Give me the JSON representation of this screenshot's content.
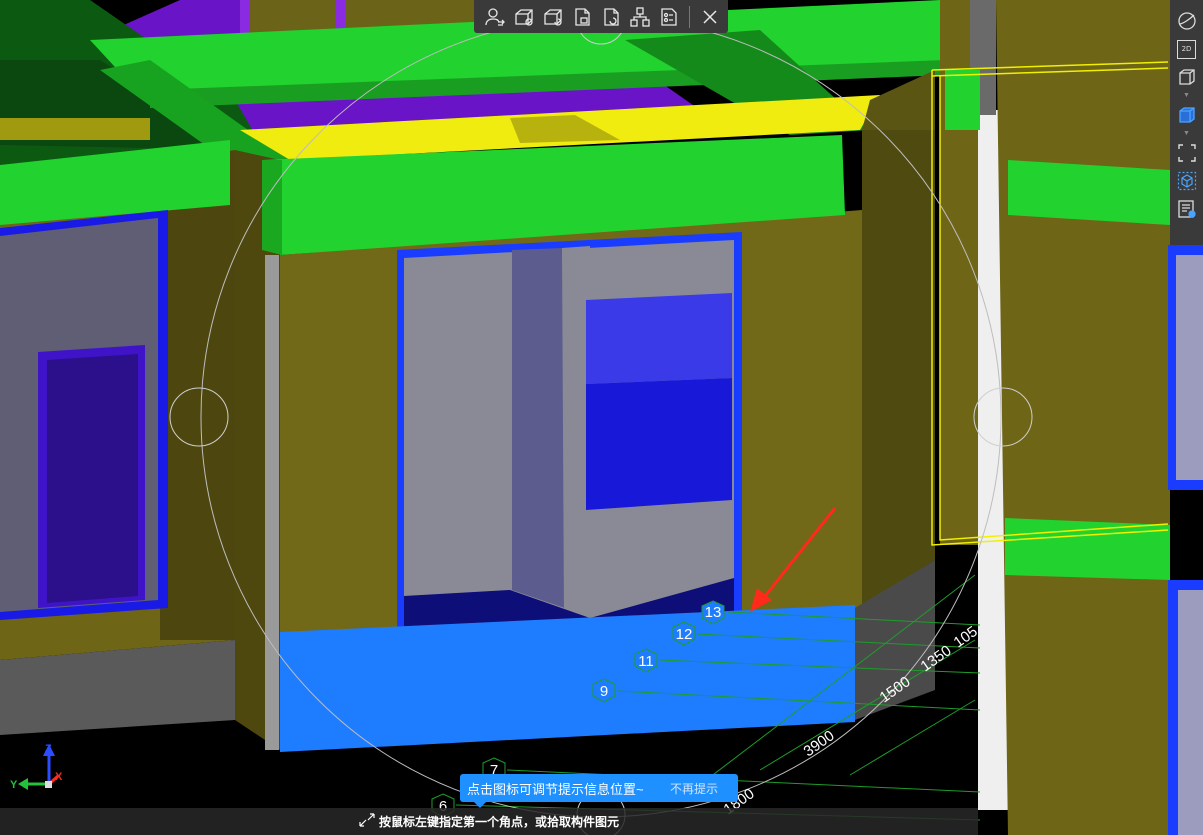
{
  "toolbar": {
    "icons": [
      "user-swap-icon",
      "box-add-icon",
      "box-refresh-icon",
      "page-link-icon",
      "page-refresh-icon",
      "hierarchy-icon",
      "checklist-icon",
      "close-icon"
    ]
  },
  "side_toolbar": {
    "items": [
      {
        "icon": "sphere-icon"
      },
      {
        "icon": "2d-view-icon",
        "label": "2D"
      },
      {
        "icon": "3d-box-icon"
      },
      {
        "icon": "solid-box-icon",
        "active": true
      },
      {
        "icon": "fit-view-icon"
      },
      {
        "icon": "cube-select-icon",
        "active": true
      },
      {
        "icon": "list-view-icon"
      }
    ]
  },
  "axis_markers": [
    {
      "label": "13"
    },
    {
      "label": "12"
    },
    {
      "label": "11"
    },
    {
      "label": "9"
    },
    {
      "label": "7"
    },
    {
      "label": "6"
    }
  ],
  "dimensions": [
    "105",
    "1350",
    "1500",
    "3900",
    "1800"
  ],
  "coordinate_axes": {
    "y": "Y",
    "z": "Z",
    "x": "X"
  },
  "tip": {
    "message": "点击图标可调节提示信息位置~",
    "dismiss": "不再提示"
  },
  "status": {
    "message": "按鼠标左键指定第一个角点，或拾取构件图元"
  },
  "colors": {
    "beam_green": "#22d22e",
    "wall_olive": "#6e6517",
    "window_blue": "#1a3cff",
    "slab_blue": "#1e7cff",
    "highlight_yellow": "#f0f000",
    "beam_purple": "#7a1ccc",
    "arrow_red": "#ff2a1a"
  }
}
